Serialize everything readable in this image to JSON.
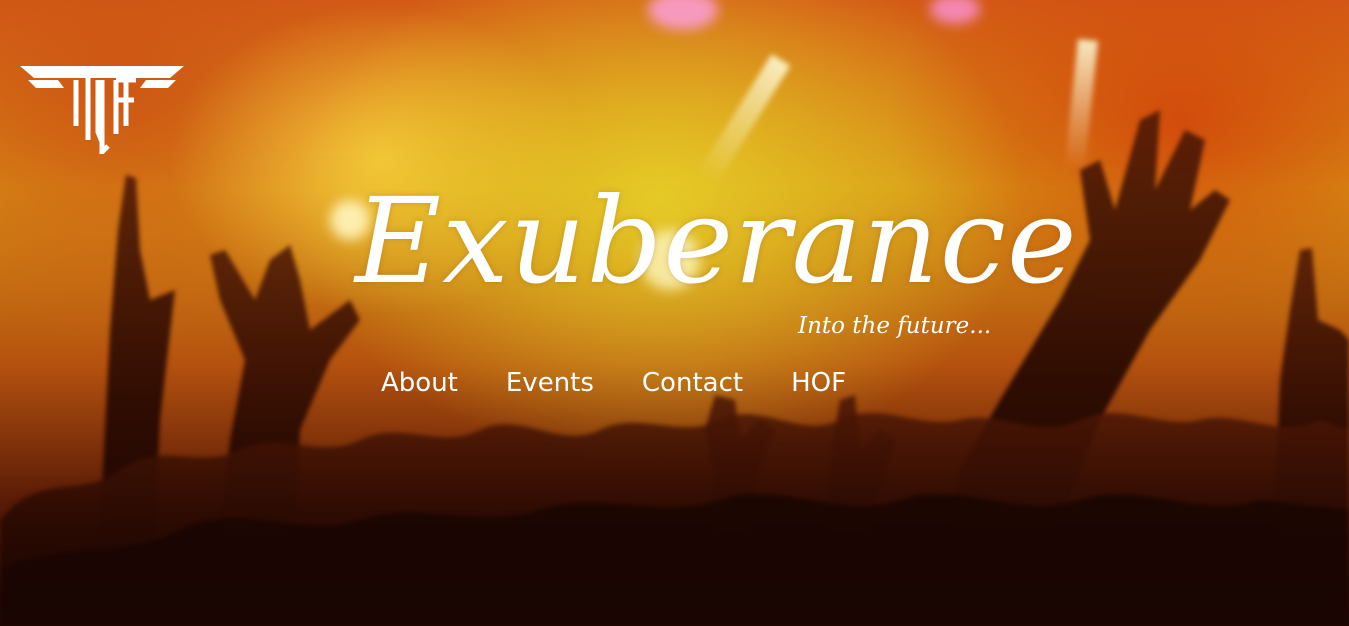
{
  "site": {
    "title": "Exuberance",
    "tagline": "Into the future...",
    "logo": {
      "icon": "winged-ttf-logo-icon",
      "color": "#ffffff"
    }
  },
  "nav": {
    "items": [
      {
        "label": "About"
      },
      {
        "label": "Events"
      },
      {
        "label": "Contact"
      },
      {
        "label": "HOF"
      }
    ]
  },
  "theme": {
    "text_color": "#ffffff",
    "background": "concert-crowd-photo",
    "accent_warm": "#d79415",
    "accent_deep": "#5a1b06"
  }
}
